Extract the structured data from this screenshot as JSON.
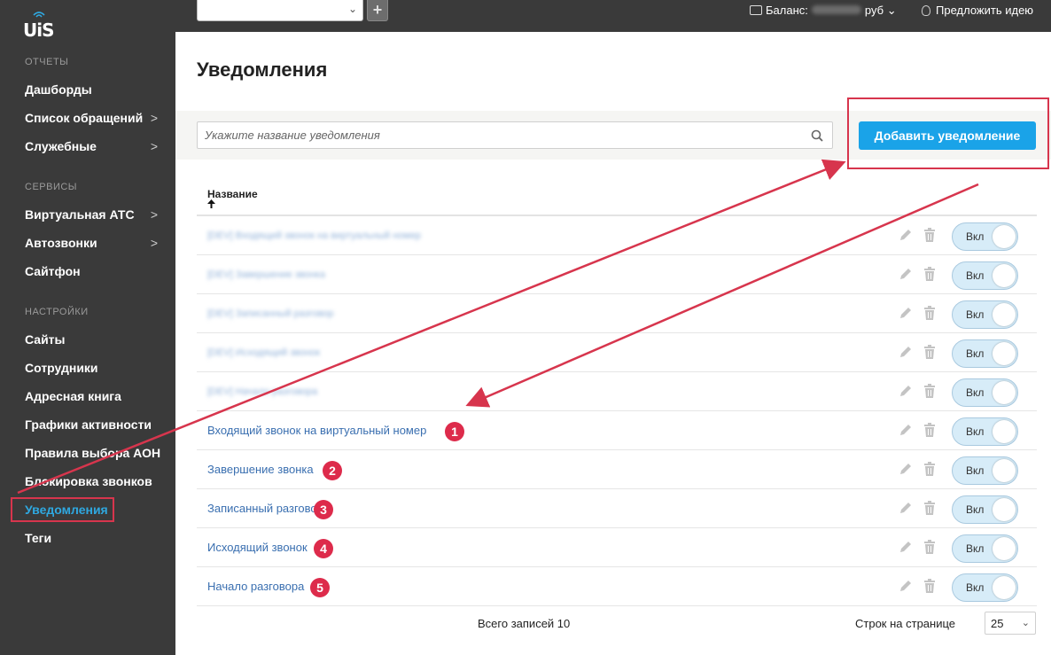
{
  "app": {
    "brand": "UiS"
  },
  "sidebar": {
    "sections": [
      {
        "title": "ОТЧЕТЫ",
        "items": [
          {
            "label": "Дашборды",
            "chevron": ""
          },
          {
            "label": "Список обращений",
            "chevron": ">"
          },
          {
            "label": "Служебные",
            "chevron": ">"
          }
        ]
      },
      {
        "title": "СЕРВИСЫ",
        "items": [
          {
            "label": "Виртуальная АТС",
            "chevron": ">"
          },
          {
            "label": "Автозвонки",
            "chevron": ">"
          },
          {
            "label": "Сайтфон",
            "chevron": ""
          }
        ]
      },
      {
        "title": "НАСТРОЙКИ",
        "items": [
          {
            "label": "Сайты",
            "chevron": ""
          },
          {
            "label": "Сотрудники",
            "chevron": ""
          },
          {
            "label": "Адресная книга",
            "chevron": ""
          },
          {
            "label": "Графики активности",
            "chevron": ""
          },
          {
            "label": "Правила выбора АОН",
            "chevron": ""
          },
          {
            "label": "Блокировка звонков",
            "chevron": ""
          },
          {
            "label": "Уведомления",
            "chevron": "",
            "active": true
          },
          {
            "label": "Теги",
            "chevron": ""
          }
        ]
      }
    ]
  },
  "topbar": {
    "select_caret": "⌄",
    "plus": "+",
    "balance_label": "Баланс:",
    "balance_currency": "руб",
    "balance_caret": "⌄",
    "suggest_label": "Предложить идею"
  },
  "page": {
    "title": "Уведомления"
  },
  "toolbar": {
    "search_placeholder": "Укажите название уведомления",
    "add_button": "Добавить уведомление"
  },
  "table": {
    "column_name": "Название",
    "sort_arrow": "🠕",
    "toggle_label": "Вкл",
    "rows": [
      {
        "name": "[DEV] Входящий звонок на виртуальный номер",
        "blurred": true,
        "badge": ""
      },
      {
        "name": "[DEV] Завершение звонка",
        "blurred": true,
        "badge": ""
      },
      {
        "name": "[DEV] Записанный разговор",
        "blurred": true,
        "badge": ""
      },
      {
        "name": "[DEV] Исходящий звонок",
        "blurred": true,
        "badge": ""
      },
      {
        "name": "[DEV] Начало разговора",
        "blurred": true,
        "badge": ""
      },
      {
        "name": "Входящий звонок на виртуальный номер",
        "blurred": false,
        "badge": "1"
      },
      {
        "name": "Завершение звонка",
        "blurred": false,
        "badge": "2"
      },
      {
        "name": "Записанный разговор",
        "blurred": false,
        "badge": "3"
      },
      {
        "name": "Исходящий звонок",
        "blurred": false,
        "badge": "4"
      },
      {
        "name": "Начало разговора",
        "blurred": false,
        "badge": "5"
      }
    ]
  },
  "footer": {
    "total": "Всего записей 10",
    "rows_per_page_label": "Строк на странице",
    "rows_per_page_value": "25",
    "caret": "⌄"
  },
  "colors": {
    "accent": "#1aa3e8",
    "highlight": "#d7354d",
    "sidebar": "#3a3a3a",
    "link": "#3a6fb0"
  }
}
